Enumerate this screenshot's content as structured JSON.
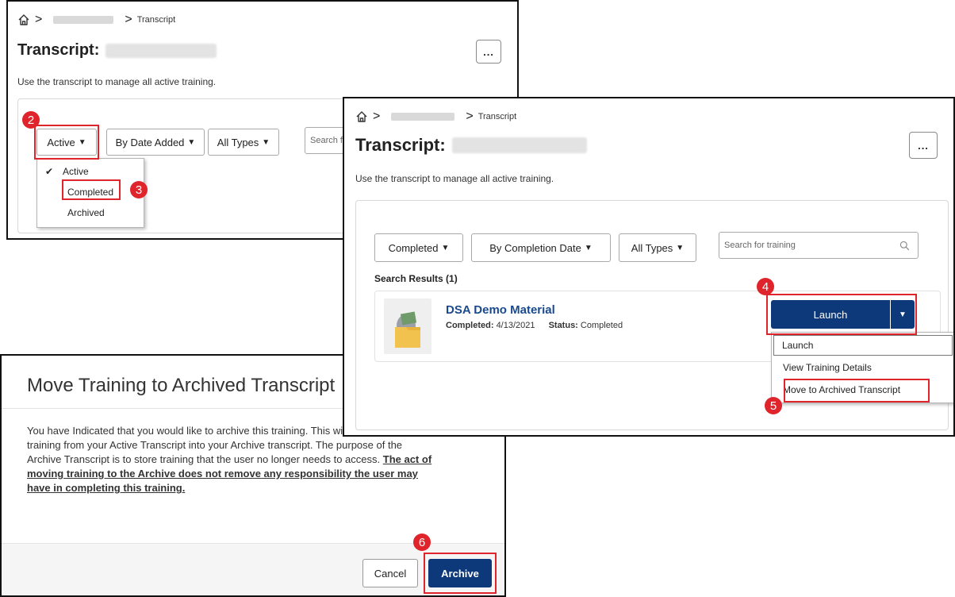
{
  "panel_a": {
    "breadcrumb_current": "Transcript",
    "title": "Transcript:",
    "description": "Use the transcript to manage all active training.",
    "more_label": "...",
    "filters": {
      "status": "Active",
      "date": "By Date Added",
      "type": "All Types",
      "search_placeholder": "Search fo"
    },
    "status_menu": [
      "Active",
      "Completed",
      "Archived"
    ],
    "check_icon": "✔",
    "steps": [
      "2",
      "3"
    ]
  },
  "panel_b": {
    "breadcrumb_current": "Transcript",
    "title": "Transcript:",
    "description": "Use the transcript to manage all active training.",
    "more_label": "...",
    "filters": {
      "status": "Completed",
      "date": "By Completion Date",
      "type": "All Types",
      "search_placeholder": "Search for training"
    },
    "results_header": "Search Results (1)",
    "result": {
      "title": "DSA Demo Material",
      "completed_label": "Completed:",
      "completed_date": "4/13/2021",
      "status_label": "Status:",
      "status_value": "Completed"
    },
    "launch_label": "Launch",
    "launch_menu": [
      "Launch",
      "View Training Details",
      "Move to Archived Transcript"
    ],
    "steps": [
      "4",
      "5"
    ]
  },
  "panel_c": {
    "title": "Move Training to Archived Transcript",
    "body_line1": "You have Indicated that you would like to archive this training. This will move the",
    "body_line2": "training from your Active Transcript into your Archive transcript. The purpose of the",
    "body_line3": "Archive Transcript is to store training that the user no longer needs to access.",
    "bold_1": "The act of",
    "bold_2": "moving training to the Archive does not remove any responsibility the user may",
    "bold_3": "have in completing this training.",
    "cancel_label": "Cancel",
    "archive_label": "Archive",
    "step": "6"
  },
  "colors": {
    "primary": "#0d3879",
    "callout": "#e0242b",
    "link": "#1a4a8e"
  }
}
